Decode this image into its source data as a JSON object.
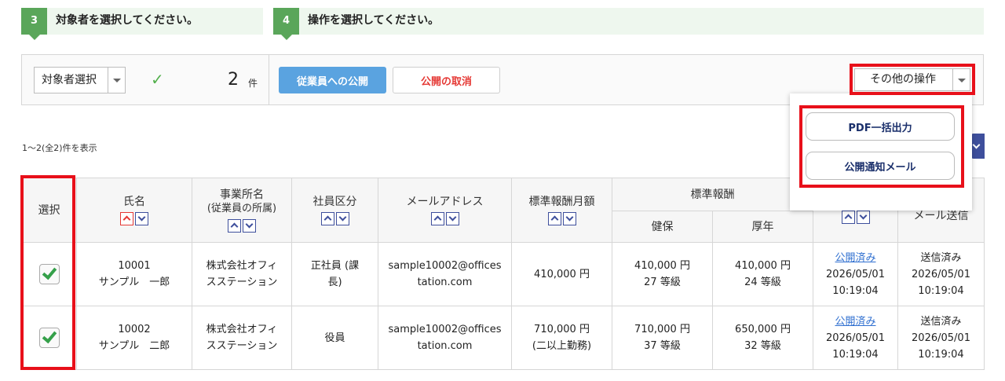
{
  "steps": [
    {
      "num": "3",
      "text": "対象者を選択してください。"
    },
    {
      "num": "4",
      "text": "操作を選択してください。"
    }
  ],
  "toolbar": {
    "target_select": "対象者選択",
    "count": "2",
    "count_unit": "件",
    "publish_button": "従業員への公開",
    "cancel_button": "公開の取消",
    "other_ops": "その他の操作"
  },
  "popup": {
    "pdf_button": "PDF一括出力",
    "mail_button": "公開通知メール"
  },
  "result_text": "1〜2(全2)件を表示",
  "table": {
    "headers": {
      "select": "選択",
      "name": "氏名",
      "office": "事業所名",
      "office_sub": "(従業員の所属)",
      "category": "社員区分",
      "email": "メールアドレス",
      "monthly": "標準報酬月額",
      "std": "標準報酬",
      "health": "健保",
      "pension": "厚年",
      "mail_send": "メール送信"
    },
    "rows": [
      {
        "emp_no": "10001",
        "emp_name": "サンプル　一郎",
        "office_a": "株式会社オフィ",
        "office_b": "スステーション",
        "cat_a": "正社員 (課",
        "cat_b": "長)",
        "email_a": "sample10002@offices",
        "email_b": "tation.com",
        "monthly_a": "410,000 円",
        "monthly_b": "",
        "health_amt": "410,000 円",
        "health_grade": "27 等級",
        "pension_amt": "410,000 円",
        "pension_grade": "24 等級",
        "pub_status": "公開済み",
        "pub_date": "2026/05/01",
        "pub_time": "10:19:04",
        "mail_status": "送信済み",
        "mail_date": "2026/05/01",
        "mail_time": "10:19:04"
      },
      {
        "emp_no": "10002",
        "emp_name": "サンプル　二郎",
        "office_a": "株式会社オフィ",
        "office_b": "スステーション",
        "cat_a": "役員",
        "cat_b": "",
        "email_a": "sample10002@offices",
        "email_b": "tation.com",
        "monthly_a": "710,000 円",
        "monthly_b": "(二以上勤務)",
        "health_amt": "710,000 円",
        "health_grade": "37 等級",
        "pension_amt": "650,000 円",
        "pension_grade": "32 等級",
        "pub_status": "公開済み",
        "pub_date": "2026/05/01",
        "pub_time": "10:19:04",
        "mail_status": "送信済み",
        "mail_date": "2026/05/01",
        "mail_time": "10:19:04"
      }
    ]
  },
  "colors": {
    "step_green": "#5aa65a",
    "publish_blue": "#5aa3e0",
    "cancel_red": "#e53935",
    "highlight_red": "#e8101a",
    "link_blue": "#2f6fd0",
    "check_green": "#35a04a",
    "popup_text": "#1a2f6b"
  }
}
